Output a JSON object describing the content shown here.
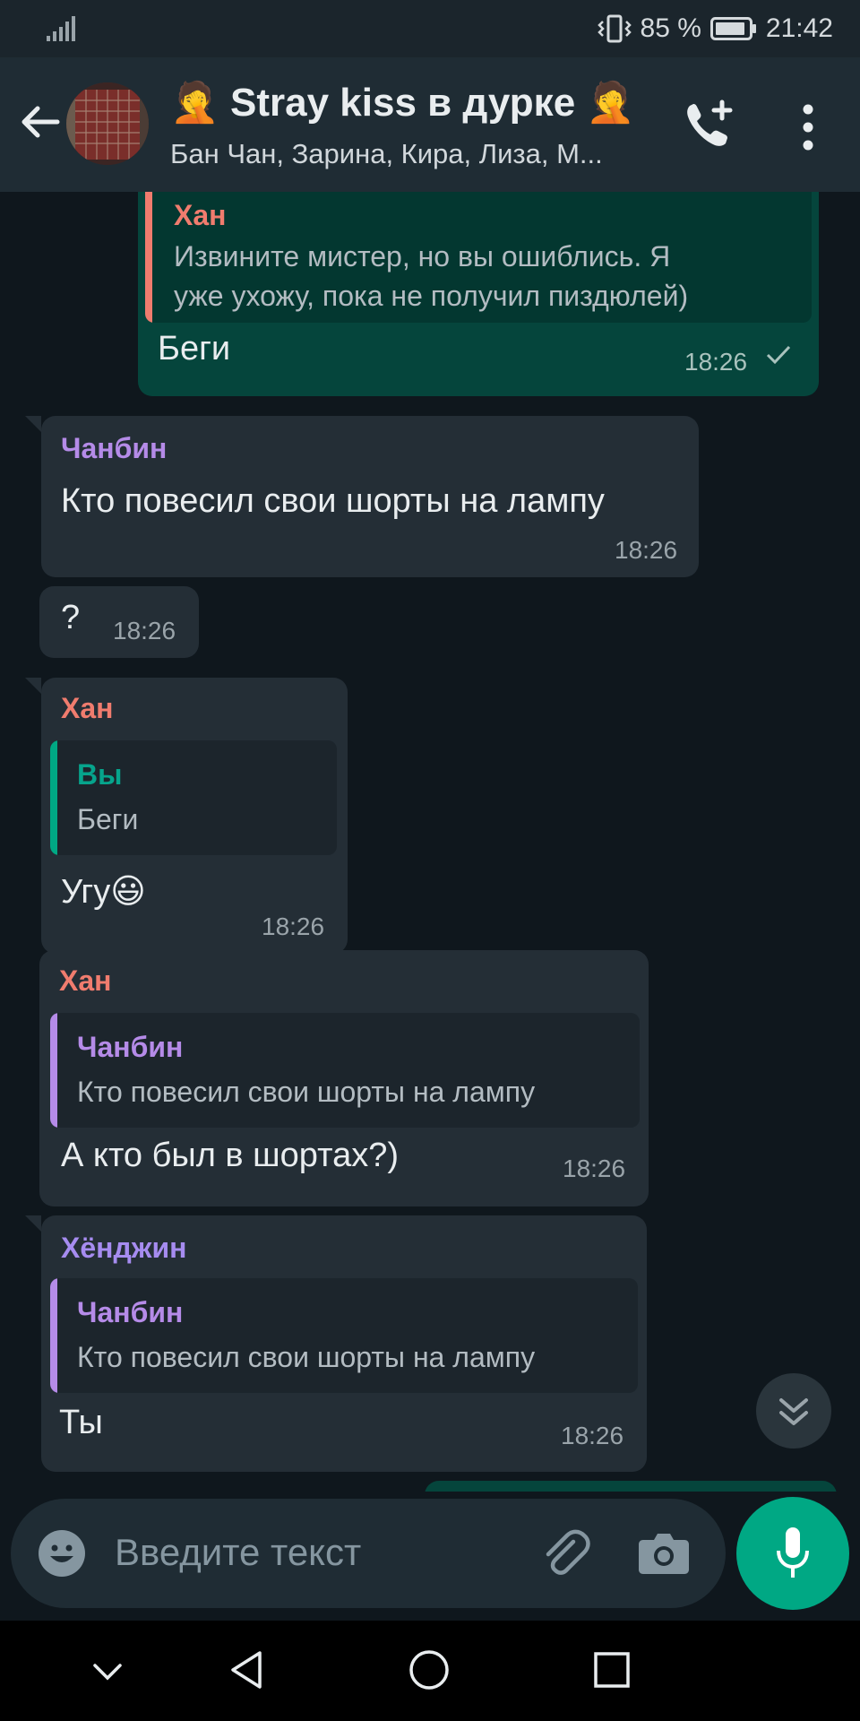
{
  "status_bar": {
    "battery": "85 %",
    "time": "21:42"
  },
  "header": {
    "title": "🤦 Stray kiss в дурке 🤦",
    "subtitle": "Бан Чан, Зарина, Кира, Лиза, М..."
  },
  "messages": [
    {
      "direction": "out",
      "quote_name": "Хан",
      "quote_text_line1": "Извините мистер, но вы ошиблись. Я",
      "quote_text_line2": "уже ухожу, пока не получил пиздюлей)",
      "text": "Беги",
      "time": "18:26",
      "status_icon": "check-icon"
    },
    {
      "direction": "in",
      "sender": "Чанбин",
      "text": "Кто повесил свои шорты на лампу",
      "time": "18:26"
    },
    {
      "direction": "in",
      "text": "?",
      "time": "18:26"
    },
    {
      "direction": "in",
      "sender": "Хан",
      "quote_name": "Вы",
      "quote_text": "Беги",
      "text": "Угу😃",
      "time": "18:26"
    },
    {
      "direction": "in",
      "sender": "Хан",
      "quote_name": "Чанбин",
      "quote_text": "Кто повесил свои шорты на лампу",
      "text": "А кто был в шортах?)",
      "time": "18:26"
    },
    {
      "direction": "in",
      "sender": "Хёнджин",
      "quote_name": "Чанбин",
      "quote_text": "Кто повесил свои шорты на лампу",
      "text": "Ты",
      "time": "18:26"
    }
  ],
  "colors": {
    "han": "#f07c6e",
    "chanbin": "#b58be8",
    "hyunjin": "#a68cf0",
    "you": "#00a884",
    "accent": "#00a884"
  },
  "input": {
    "placeholder": "Введите текст"
  },
  "icons": [
    "back-icon",
    "call-add-icon",
    "more-icon",
    "emoji-icon",
    "attach-icon",
    "camera-icon",
    "mic-icon",
    "scroll-down-icon"
  ]
}
